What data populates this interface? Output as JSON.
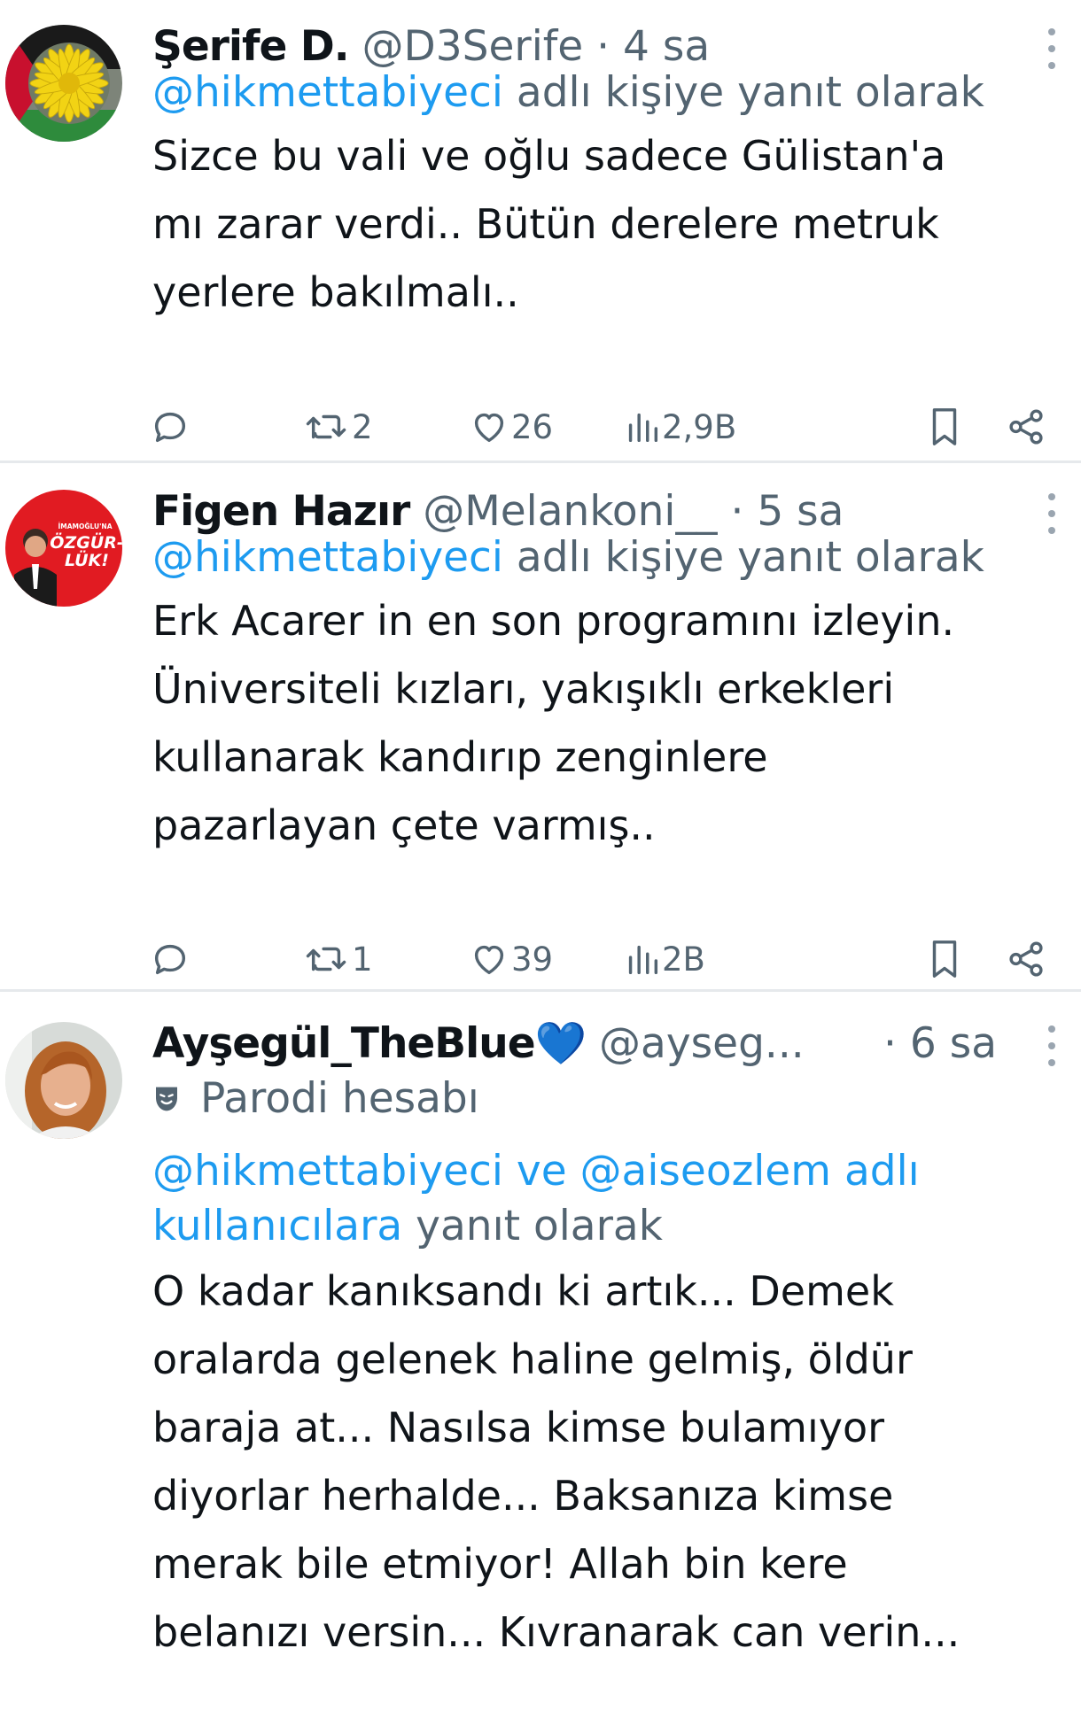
{
  "tweets": [
    {
      "display_name": "Şerife D.",
      "handle": "@D3Serife",
      "time": "· 4 sa",
      "reply_mention": "@hikmettabiyeci",
      "reply_suffix": " adlı kişiye yanıt olarak",
      "body_lines": [
        "Sizce bu vali ve oğlu sadece Gülistan'a",
        "mı zarar verdi.. Bütün derelere metruk",
        "yerlere bakılmalı.."
      ],
      "retweets": "2",
      "likes": "26",
      "views": "2,9B"
    },
    {
      "display_name": "Figen Hazır",
      "handle": "@Melankoni__",
      "time": "· 5 sa",
      "reply_mention": "@hikmettabiyeci",
      "reply_suffix": " adlı kişiye yanıt olarak",
      "avatar_text": [
        "İMAMOĞLU'NA",
        "ÖZGÜR-",
        "LÜK!"
      ],
      "body_lines": [
        "Erk Acarer in en son programını izleyin.",
        "Üniversiteli kızları, yakışıklı erkekleri",
        "kullanarak kandırıp  zenginlere",
        "pazarlayan çete varmış.."
      ],
      "retweets": "1",
      "likes": "39",
      "views": "2B"
    },
    {
      "display_name": "Ayşegül_TheBlue💙",
      "handle": "@ayseg...",
      "time": "· 6 sa",
      "parody_label": "Parodi hesabı",
      "reply_line1_mention": "@hikmettabiyeci ve @aiseozlem adlı",
      "reply_line2_mention": "kullanıcılara",
      "reply_line2_suffix": " yanıt olarak",
      "body_lines": [
        "O kadar kanıksandı ki artık... Demek",
        "oralarda gelenek haline gelmiş, öldür",
        "baraja at... Nasılsa kimse bulamıyor",
        "diyorlar herhalde... Baksanıza kimse",
        "merak bile etmiyor! Allah bin kere",
        "belanızı versin... Kıvranarak can verin..."
      ]
    }
  ],
  "icons": [
    "reply-icon",
    "retweet-icon",
    "like-icon",
    "views-icon",
    "bookmark-icon",
    "share-icon",
    "more-icon",
    "parody-mask-icon"
  ],
  "colors": {
    "accent": "#1d9bf0",
    "secondary_text": "#536471",
    "primary_text": "#0f1419",
    "divider": "#e6e9ec"
  }
}
